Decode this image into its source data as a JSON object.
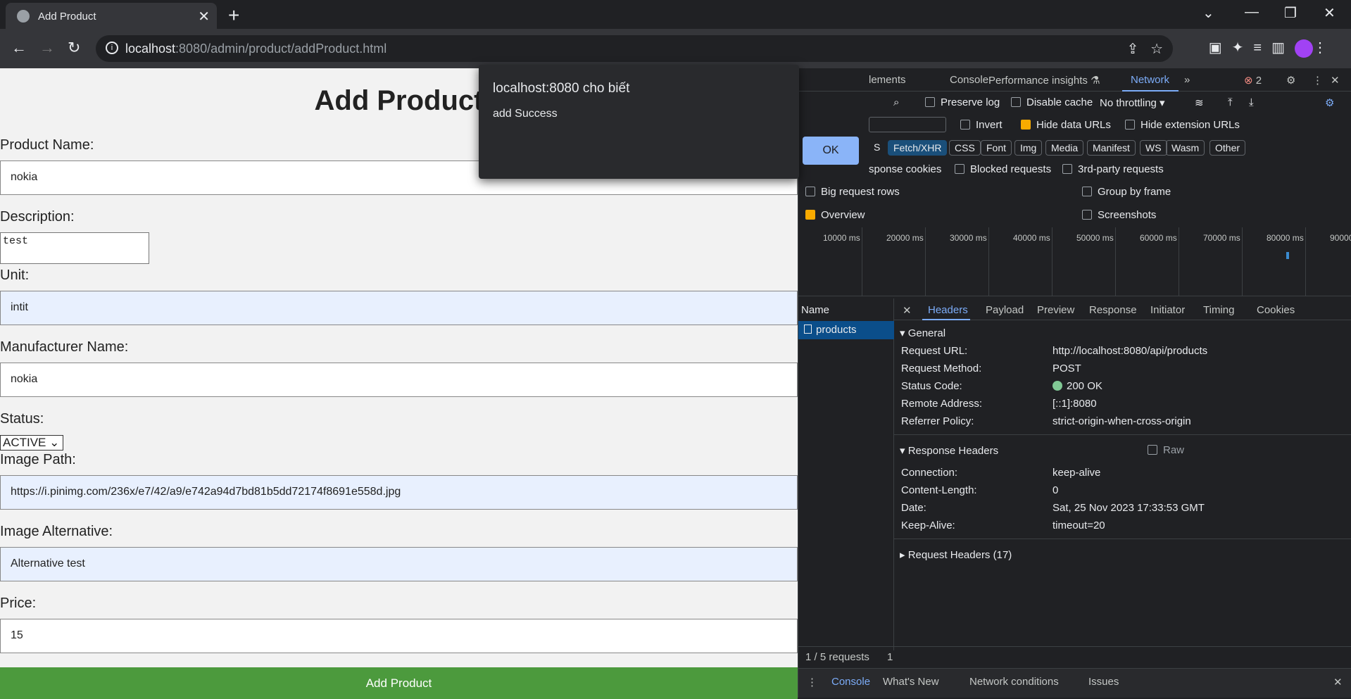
{
  "browser": {
    "tab_title": "Add Product",
    "url_host": "localhost",
    "url_rest": ":8080/admin/product/addProduct.html"
  },
  "form": {
    "title": "Add Product",
    "product_name_label": "Product Name:",
    "product_name": "nokia",
    "description_label": "Description:",
    "description": "test",
    "unit_label": "Unit:",
    "unit": "intit",
    "manufacturer_label": "Manufacturer Name:",
    "manufacturer": "nokia",
    "status_label": "Status:",
    "status": "ACTIVE",
    "image_path_label": "Image Path:",
    "image_path": "https://i.pinimg.com/236x/e7/42/a9/e742a94d7bd81b5dd72174f8691e558d.jpg",
    "image_alt_label": "Image Alternative:",
    "image_alt": "Alternative test",
    "price_label": "Price:",
    "price": "15",
    "submit_label": "Add Product"
  },
  "dialog": {
    "title": "localhost:8080 cho biết",
    "message": "add Success",
    "ok_label": "OK"
  },
  "devtools": {
    "tabs": [
      "lements",
      "Console",
      "Performance insights",
      "Network"
    ],
    "error_count": "2",
    "preserve_log": "Preserve log",
    "disable_cache": "Disable cache",
    "throttling": "No throttling",
    "invert": "Invert",
    "hide_data_urls": "Hide data URLs",
    "hide_extension_urls": "Hide extension URLs",
    "filters": [
      "S",
      "Fetch/XHR",
      "CSS",
      "Font",
      "Img",
      "Media",
      "Manifest",
      "WS",
      "Wasm",
      "Other"
    ],
    "response_cookies": "sponse cookies",
    "blocked_requests": "Blocked requests",
    "third_party": "3rd-party requests",
    "big_rows": "Big request rows",
    "group_by_frame": "Group by frame",
    "overview": "Overview",
    "screenshots": "Screenshots",
    "ticks": [
      "10000 ms",
      "20000 ms",
      "30000 ms",
      "40000 ms",
      "50000 ms",
      "60000 ms",
      "70000 ms",
      "80000 ms",
      "90000"
    ],
    "name_header": "Name",
    "request_name": "products",
    "detail_tabs": [
      "Headers",
      "Payload",
      "Preview",
      "Response",
      "Initiator",
      "Timing",
      "Cookies"
    ],
    "general_title": "General",
    "general": [
      {
        "k": "Request URL:",
        "v": "http://localhost:8080/api/products"
      },
      {
        "k": "Request Method:",
        "v": "POST"
      },
      {
        "k": "Status Code:",
        "v": "200 OK"
      },
      {
        "k": "Remote Address:",
        "v": "[::1]:8080"
      },
      {
        "k": "Referrer Policy:",
        "v": "strict-origin-when-cross-origin"
      }
    ],
    "response_headers_title": "Response Headers",
    "raw_label": "Raw",
    "response_headers": [
      {
        "k": "Connection:",
        "v": "keep-alive"
      },
      {
        "k": "Content-Length:",
        "v": "0"
      },
      {
        "k": "Date:",
        "v": "Sat, 25 Nov 2023 17:33:53 GMT"
      },
      {
        "k": "Keep-Alive:",
        "v": "timeout=20"
      }
    ],
    "request_headers_title": "Request Headers (17)",
    "requests_summary": "1 / 5 requests",
    "summary_extra": "1",
    "drawer_tabs": [
      "Console",
      "What's New",
      "Network conditions",
      "Issues"
    ]
  }
}
